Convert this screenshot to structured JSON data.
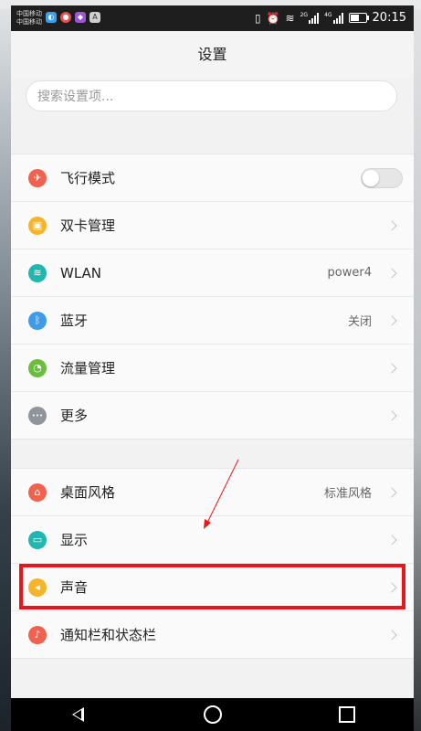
{
  "status_bar": {
    "carrier_1": "中国移动",
    "carrier_2": "中国移动",
    "network_1": "2G",
    "network_2": "4G",
    "time": "20:15"
  },
  "header": {
    "title": "设置"
  },
  "search": {
    "placeholder": "搜索设置项..."
  },
  "group_1": [
    {
      "label": "飞行模式",
      "icon": "airplane-icon",
      "color": "#f0614e",
      "control": "toggle",
      "toggle_on": false
    },
    {
      "label": "双卡管理",
      "icon": "sim-card-icon",
      "color": "#f6b42a",
      "control": "chevron"
    },
    {
      "label": "WLAN",
      "icon": "wifi-icon",
      "color": "#21b7b0",
      "value": "power4",
      "control": "chevron"
    },
    {
      "label": "蓝牙",
      "icon": "bluetooth-icon",
      "color": "#3d9bea",
      "value": "关闭",
      "control": "chevron"
    },
    {
      "label": "流量管理",
      "icon": "data-usage-icon",
      "color": "#6bbd3d",
      "control": "chevron"
    },
    {
      "label": "更多",
      "icon": "more-icon",
      "color": "#8f959b",
      "control": "chevron"
    }
  ],
  "group_2": [
    {
      "label": "桌面风格",
      "icon": "home-style-icon",
      "color": "#f0614e",
      "value": "标准风格",
      "control": "chevron"
    },
    {
      "label": "显示",
      "icon": "display-icon",
      "color": "#21b7b0",
      "control": "chevron"
    },
    {
      "label": "声音",
      "icon": "sound-icon",
      "color": "#f6b42a",
      "control": "chevron"
    },
    {
      "label": "通知栏和状态栏",
      "icon": "notification-icon",
      "color": "#f0614e",
      "control": "chevron"
    }
  ],
  "colors": {
    "annotation_box": "#e8151b",
    "annotation_arrow": "#e8151b"
  }
}
